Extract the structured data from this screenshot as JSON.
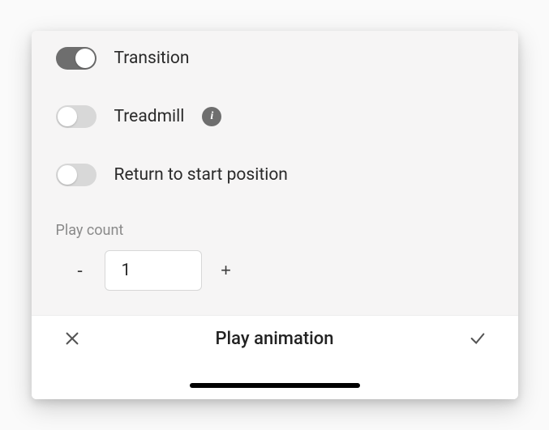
{
  "toggles": {
    "transition": {
      "label": "Transition",
      "state": "on"
    },
    "treadmill": {
      "label": "Treadmill",
      "state": "off"
    },
    "returnStart": {
      "label": "Return to start position",
      "state": "off"
    }
  },
  "playCount": {
    "label": "Play count",
    "value": "1",
    "minus": "-",
    "plus": "+"
  },
  "footer": {
    "title": "Play animation"
  }
}
